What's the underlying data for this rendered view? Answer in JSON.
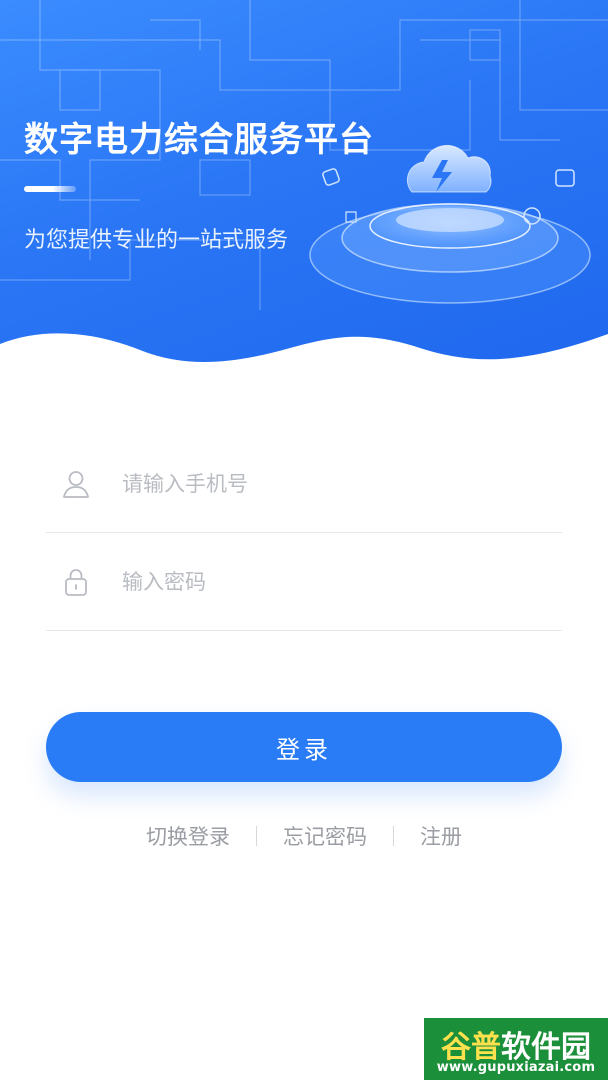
{
  "hero": {
    "title": "数字电力综合服务平台",
    "subtitle": "为您提供专业的一站式服务"
  },
  "form": {
    "phone": {
      "placeholder": "请输入手机号",
      "value": "",
      "icon": "user-icon"
    },
    "password": {
      "placeholder": "输入密码",
      "value": "",
      "icon": "lock-icon"
    }
  },
  "login_button": "登录",
  "links": [
    "切换登录",
    "忘记密码",
    "注册"
  ],
  "watermark": {
    "title_a": "谷普",
    "title_b": "软件园",
    "url": "www.gupuxiazai.com"
  },
  "colors": {
    "primary": "#2a7cf6",
    "hero_gradient_start": "#3b8cff",
    "hero_gradient_end": "#1f67ee",
    "link_text": "#9a9da3",
    "placeholder": "#b9bcc2",
    "watermark_green": "#1b8f3a"
  }
}
